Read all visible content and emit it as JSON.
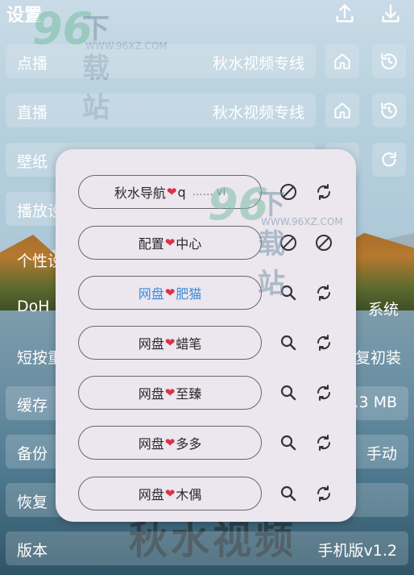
{
  "header": {
    "title": "设置"
  },
  "rows": [
    {
      "label": "点播",
      "value": "秋水视频专线"
    },
    {
      "label": "直播",
      "value": "秋水视频专线"
    },
    {
      "label": "壁纸",
      "value": ""
    },
    {
      "label": "播放设",
      "value": ""
    }
  ],
  "plain_rows": [
    {
      "label": "个性设",
      "value": ""
    },
    {
      "label": "DoH",
      "value": "系统"
    },
    {
      "label": "短按重",
      "value": "复初装"
    },
    {
      "label": "缓存",
      "value": "5.3 MB"
    },
    {
      "label": "备份",
      "value": "手动"
    },
    {
      "label": "恢复",
      "value": ""
    },
    {
      "label": "版本",
      "value": "手机版v1.2"
    }
  ],
  "watermark": {
    "digits": "96",
    "text": "下载站",
    "url": "WWW.96XZ.COM"
  },
  "background_text": "秋水视频",
  "dialog": {
    "items": [
      {
        "before": "秋水导航",
        "after": "q",
        "suffix": "…… vi"
      },
      {
        "before": "配置",
        "after": "中心"
      },
      {
        "before": "网盘",
        "after": "肥猫"
      },
      {
        "before": "网盘",
        "after": "蜡笔"
      },
      {
        "before": "网盘",
        "after": "至臻"
      },
      {
        "before": "网盘",
        "after": "多多"
      },
      {
        "before": "网盘",
        "after": "木偶"
      }
    ]
  },
  "colors": {
    "active_item": "#3b8bd8",
    "heart": "#d9334a",
    "dialog_bg": "#ece6ee"
  }
}
